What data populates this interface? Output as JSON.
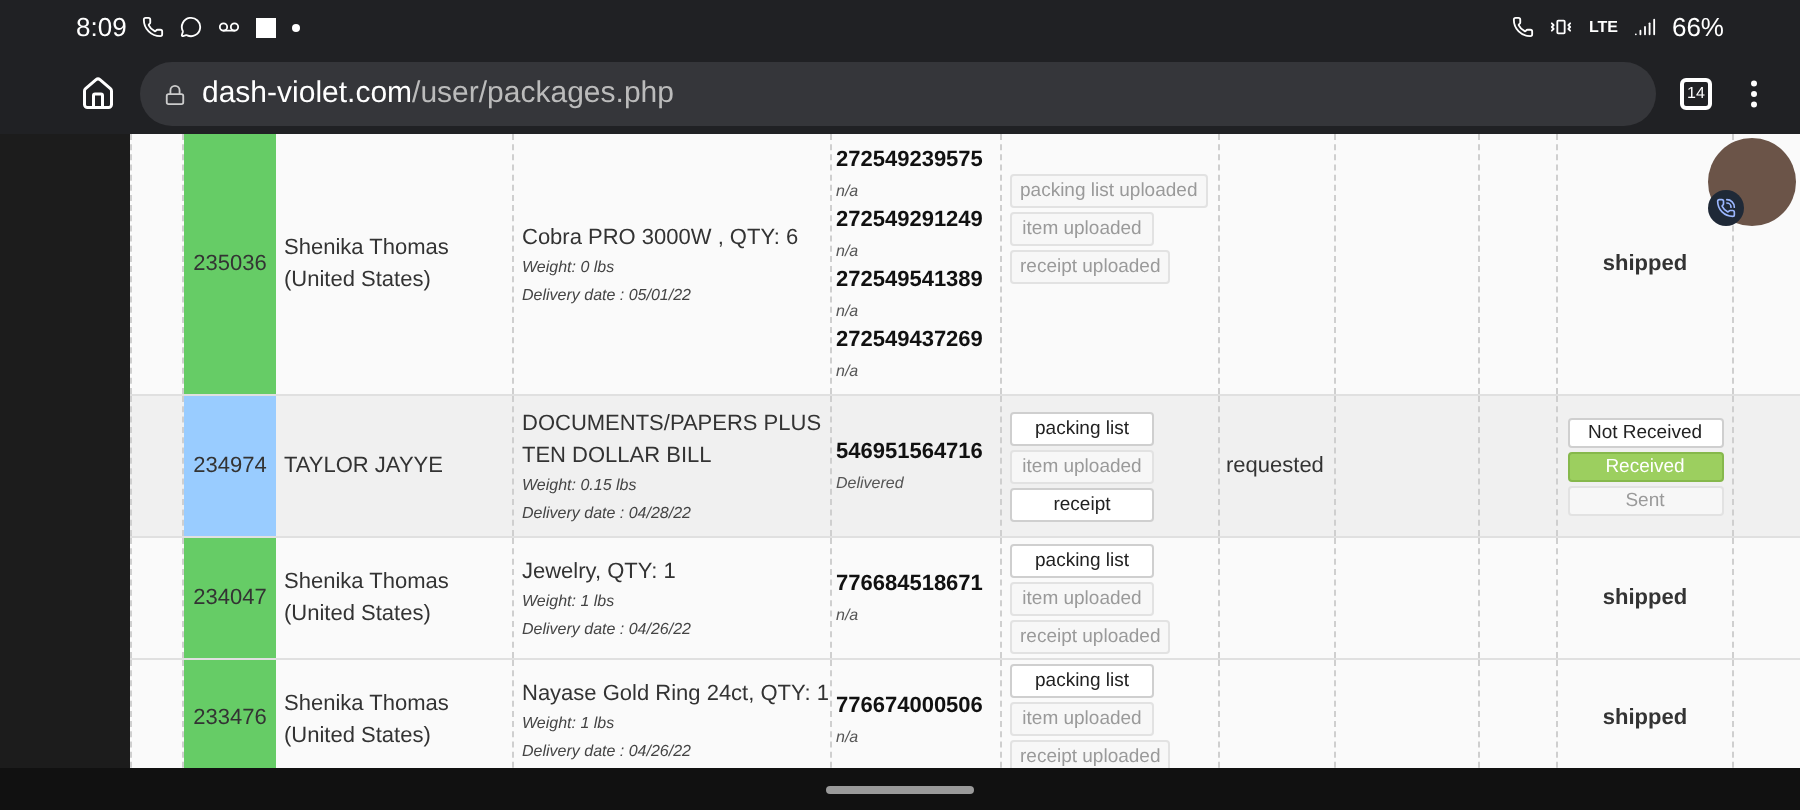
{
  "status_bar": {
    "time": "8:09",
    "network": "LTE",
    "battery": "66%"
  },
  "browser": {
    "url_host": "dash-violet.com",
    "url_path": "/user/packages.php",
    "tab_count": "14"
  },
  "rows": [
    {
      "id": "235036",
      "color": "#66cc66",
      "customer_lines": [
        "Shenika Thomas",
        "(United States)"
      ],
      "description": "Cobra PRO 3000W , QTY: 6",
      "weight": "Weight: 0 lbs",
      "delivery_date": "Delivery date : 05/01/22",
      "trackings": [
        {
          "number": "272549239575",
          "status": "n/a"
        },
        {
          "number": "272549291249",
          "status": "n/a"
        },
        {
          "number": "272549541389",
          "status": "n/a"
        },
        {
          "number": "272549437269",
          "status": "n/a"
        }
      ],
      "documents": [
        {
          "label": "packing list uploaded",
          "kind": "uploaded"
        },
        {
          "label": "item uploaded",
          "kind": "uploaded"
        },
        {
          "label": "receipt uploaded",
          "kind": "uploaded"
        }
      ],
      "status": {
        "kind": "text",
        "text": "shipped"
      }
    },
    {
      "id": "234974",
      "color": "#99ccff",
      "customer_lines": [
        "TAYLOR JAYYE"
      ],
      "description": "DOCUMENTS/PAPERS PLUS TEN DOLLAR BILL",
      "weight": "Weight: 0.15 lbs",
      "delivery_date": "Delivery date : 04/28/22",
      "trackings": [
        {
          "number": "546951564716",
          "status": "Delivered"
        }
      ],
      "documents": [
        {
          "label": "packing list",
          "kind": "button"
        },
        {
          "label": "item uploaded",
          "kind": "uploaded"
        },
        {
          "label": "receipt",
          "kind": "button"
        }
      ],
      "request": "requested",
      "status": {
        "kind": "options",
        "options": [
          {
            "label": "Not Received",
            "selected": false,
            "disabled": false
          },
          {
            "label": "Received",
            "selected": true,
            "disabled": false
          },
          {
            "label": "Sent",
            "selected": false,
            "disabled": true
          }
        ]
      }
    },
    {
      "id": "234047",
      "color": "#66cc66",
      "customer_lines": [
        "Shenika Thomas",
        "(United States)"
      ],
      "description": "Jewelry, QTY: 1",
      "weight": "Weight: 1 lbs",
      "delivery_date": "Delivery date : 04/26/22",
      "trackings": [
        {
          "number": "776684518671",
          "status": "n/a"
        }
      ],
      "documents": [
        {
          "label": "packing list",
          "kind": "button"
        },
        {
          "label": "item uploaded",
          "kind": "uploaded"
        },
        {
          "label": "receipt uploaded",
          "kind": "uploaded"
        }
      ],
      "status": {
        "kind": "text",
        "text": "shipped"
      }
    },
    {
      "id": "233476",
      "color": "#66cc66",
      "customer_lines": [
        "Shenika Thomas",
        "(United States)"
      ],
      "description": "Nayase Gold Ring 24ct, QTY: 1",
      "weight": "Weight: 1 lbs",
      "delivery_date": "Delivery date : 04/26/22",
      "trackings": [
        {
          "number": "776674000506",
          "status": "n/a"
        }
      ],
      "documents": [
        {
          "label": "packing list",
          "kind": "button"
        },
        {
          "label": "item uploaded",
          "kind": "uploaded"
        },
        {
          "label": "receipt uploaded",
          "kind": "uploaded"
        }
      ],
      "status": {
        "kind": "text",
        "text": "shipped"
      }
    }
  ]
}
